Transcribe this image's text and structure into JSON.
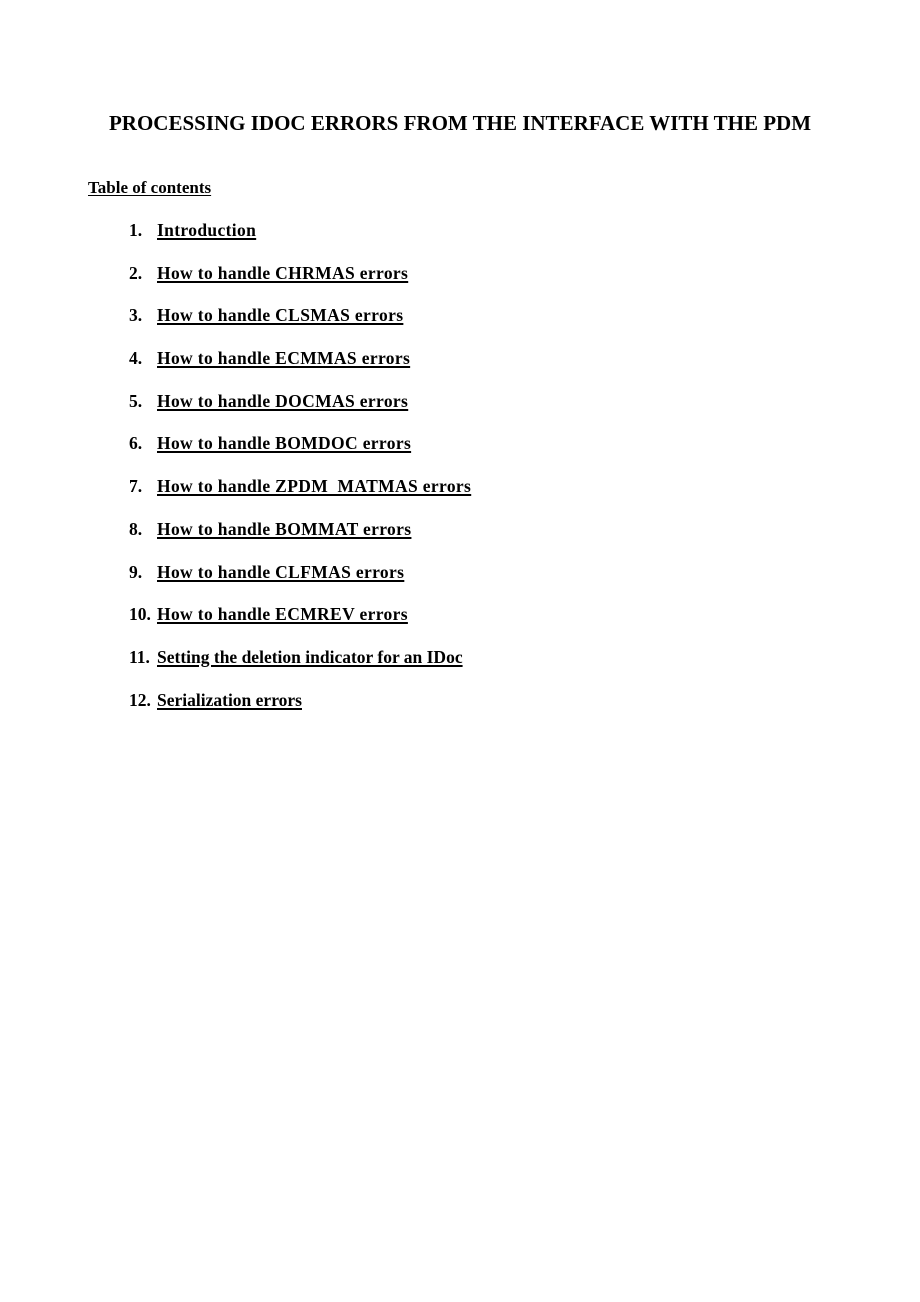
{
  "document": {
    "title": "PROCESSING IDOC ERRORS FROM THE INTERFACE WITH THE PDM",
    "toc_heading": "Table of contents",
    "toc_items": [
      {
        "number": "1.",
        "label": "Introduction"
      },
      {
        "number": "2.",
        "label": "How to handle CHRMAS errors"
      },
      {
        "number": "3.",
        "label": "How to handle CLSMAS errors"
      },
      {
        "number": "4.",
        "label": "How to handle ECMMAS errors"
      },
      {
        "number": "5.",
        "label": "How to handle DOCMAS errors"
      },
      {
        "number": "6.",
        "label": "How to handle BOMDOC errors"
      },
      {
        "number": "7.",
        "label": "How to handle ZPDM  MATMAS errors"
      },
      {
        "number": "8.",
        "label": "How to handle BOMMAT errors"
      },
      {
        "number": "9.",
        "label": "How to handle CLFMAS errors"
      },
      {
        "number": "10.",
        "label": "How to handle ECMREV errors"
      },
      {
        "number": "11.",
        "label": "Setting the deletion indicator for an IDoc"
      },
      {
        "number": "12.",
        "label": "Serialization errors"
      }
    ]
  }
}
